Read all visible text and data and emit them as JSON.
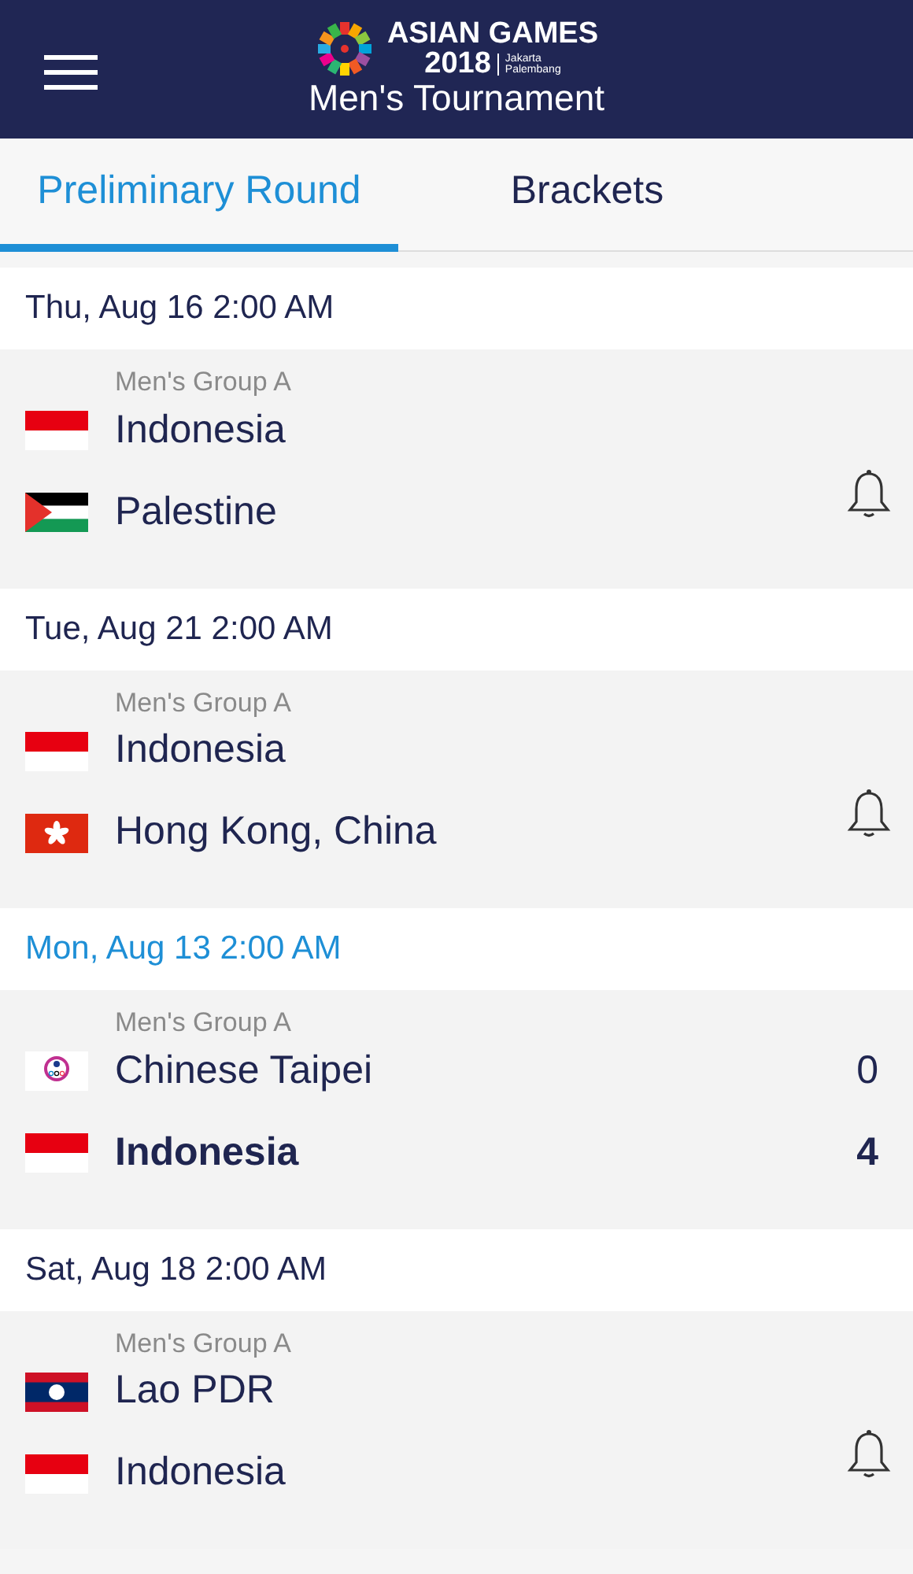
{
  "header": {
    "logo": {
      "name": "ASIAN GAMES",
      "year": "2018",
      "cities": [
        "Jakarta",
        "Palembang"
      ]
    },
    "title": "Men's Tournament"
  },
  "tabs": [
    {
      "label": "Preliminary Round",
      "selected": true
    },
    {
      "label": "Brackets",
      "selected": false
    }
  ],
  "matches": [
    {
      "date": "Thu, Aug 16 2:00 AM",
      "highlighted": false,
      "group": "Men's Group A",
      "kind": "upcoming",
      "teams": [
        {
          "name": "Indonesia",
          "kind": "indonesia",
          "winner": false
        },
        {
          "name": "Palestine",
          "kind": "palestine",
          "winner": false
        }
      ]
    },
    {
      "date": "Tue, Aug 21 2:00 AM",
      "highlighted": false,
      "group": "Men's Group A",
      "kind": "upcoming",
      "teams": [
        {
          "name": "Indonesia",
          "kind": "indonesia",
          "winner": false
        },
        {
          "name": "Hong Kong, China",
          "kind": "hongkong",
          "winner": false
        }
      ]
    },
    {
      "date": "Mon, Aug 13 2:00 AM",
      "highlighted": true,
      "group": "Men's Group A",
      "kind": "result",
      "teams": [
        {
          "name": "Chinese Taipei",
          "kind": "taipei",
          "winner": false,
          "score": "0"
        },
        {
          "name": "Indonesia",
          "kind": "indonesia",
          "winner": true,
          "score": "4"
        }
      ]
    },
    {
      "date": "Sat, Aug 18 2:00 AM",
      "highlighted": false,
      "group": "Men's Group A",
      "kind": "upcoming",
      "teams": [
        {
          "name": "Lao PDR",
          "kind": "lao",
          "winner": false
        },
        {
          "name": "Indonesia",
          "kind": "indonesia",
          "winner": false
        }
      ]
    }
  ]
}
